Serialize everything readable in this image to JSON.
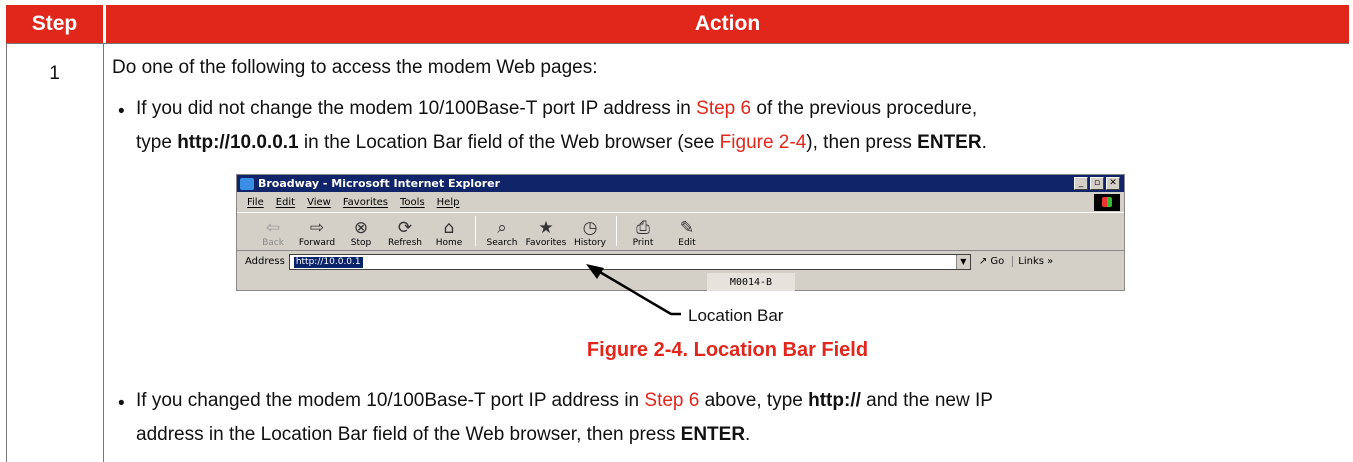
{
  "table": {
    "header_step": "Step",
    "header_action": "Action",
    "step_number": "1",
    "intro": "Do one of the following to access the modem Web pages:",
    "bullet1": {
      "line1_a": "If you did not change the modem 10/100Base-T port IP address in ",
      "line1_link": "Step 6",
      "line1_b": " of the previous procedure,",
      "line2_a": "type ",
      "line2_bold": "http://10.0.0.1",
      "line2_b": " in the Location Bar field of the Web browser (see ",
      "line2_link": "Figure 2-4",
      "line2_c": "), then press ",
      "line2_bold2": "ENTER",
      "line2_d": "."
    },
    "bullet2": {
      "line1_a": "If you changed the modem 10/100Base-T port IP address in ",
      "line1_link": "Step 6",
      "line1_b": " above, type ",
      "line1_bold": "http://",
      "line1_c": " and the new IP",
      "line2_a": "address in the Location Bar field of the Web browser, then press ",
      "line2_bold": "ENTER",
      "line2_b": "."
    }
  },
  "browser": {
    "title": "Broadway - Microsoft Internet Explorer",
    "menu": [
      "File",
      "Edit",
      "View",
      "Favorites",
      "Tools",
      "Help"
    ],
    "toolbar": [
      {
        "label": "Back",
        "icon": "back-arrow-icon"
      },
      {
        "label": "Forward",
        "icon": "forward-arrow-icon"
      },
      {
        "label": "Stop",
        "icon": "stop-icon"
      },
      {
        "label": "Refresh",
        "icon": "refresh-icon"
      },
      {
        "label": "Home",
        "icon": "home-icon"
      },
      {
        "label": "Search",
        "icon": "search-icon"
      },
      {
        "label": "Favorites",
        "icon": "favorites-icon"
      },
      {
        "label": "History",
        "icon": "history-icon"
      },
      {
        "label": "Print",
        "icon": "print-icon"
      },
      {
        "label": "Edit",
        "icon": "edit-icon"
      }
    ],
    "address_label": "Address",
    "address_value": "http://10.0.0.1",
    "go_label": "Go",
    "links_label": "Links",
    "overlay_code": "M0014-B"
  },
  "figure": {
    "callout": "Location Bar",
    "caption": "Figure 2-4. Location Bar Field"
  },
  "colors": {
    "accent": "#e1261c",
    "ie_title": "#10246a",
    "ie_chrome": "#d4d0c8"
  }
}
